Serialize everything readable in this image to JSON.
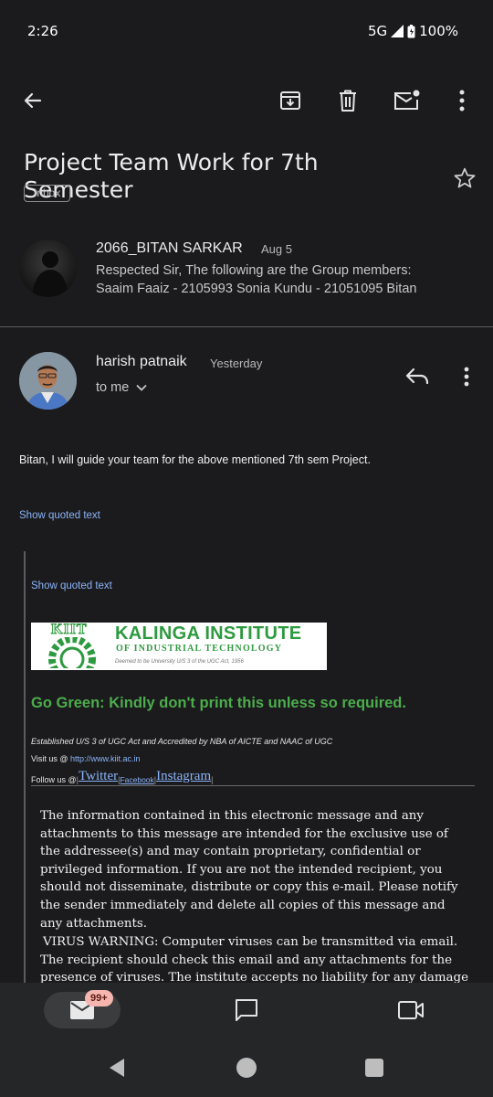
{
  "status_bar": {
    "time": "2:26",
    "network": "5G",
    "battery": "100%"
  },
  "toolbar": {
    "back_icon": "arrow-left",
    "archive_icon": "archive",
    "delete_icon": "trash",
    "unread_icon": "mail-unread",
    "more_icon": "more-vertical"
  },
  "email": {
    "subject": "Project Team Work for 7th Semester",
    "label": "Inbox",
    "star_icon": "star-outline"
  },
  "thread": [
    {
      "sender": "2066_BITAN SARKAR",
      "date": "Aug 5",
      "snippet_line1": "Respected Sir, The following are the Group members:",
      "snippet_line2": "Saaim Faaiz - 2105993 Sonia Kundu - 21051095 Bitan"
    },
    {
      "sender": "harish patnaik",
      "date": "Yesterday",
      "recipient": "to me",
      "body": "Bitan, I will guide your team for the above mentioned 7th sem Project.",
      "show_quoted_1": "Show quoted text",
      "show_quoted_2": "Show quoted text"
    }
  ],
  "signature": {
    "logo_text": "KIIT",
    "org_name": "KALINGA INSTITUTE",
    "org_sub": "OF INDUSTRIAL TECHNOLOGY",
    "org_tag": "Deemed to be University U/S 3 of the UGC Act, 1956",
    "go_green": "Go Green: Kindly don't print this unless so required.",
    "established": "Established U/S 3 of UGC Act and Accredited by NBA of AICTE and NAAC of UGC",
    "visit_prefix": "Visit us @ ",
    "visit_link": "http://www.kiit.ac.in",
    "follow_prefix": "Follow us @ ",
    "twitter": "Twitter",
    "facebook": "Facebook",
    "instagram": "Instagram",
    "disclaimer": "The information contained in this electronic message and any attachments to this message are intended for the exclusive use of the addressee(s) and may contain proprietary, confidential or privileged information. If you are not the intended recipient, you should not disseminate, distribute or copy this e-mail. Please notify the sender immediately and delete all copies of this message and any attachments.",
    "virus_warning": "VIRUS WARNING: Computer viruses can be transmitted via email. The recipient should check this email and any attachments for the presence of viruses. The institute accepts no liability for any damage caused by"
  },
  "bottom_nav": {
    "mail_badge": "99+",
    "mail_icon": "mail",
    "chat_icon": "chat",
    "meet_icon": "video"
  },
  "colors": {
    "background": "#1b1b1d",
    "link": "#8ab4f8",
    "go_green": "#4cad4c",
    "badge": "#f4b6ae"
  }
}
